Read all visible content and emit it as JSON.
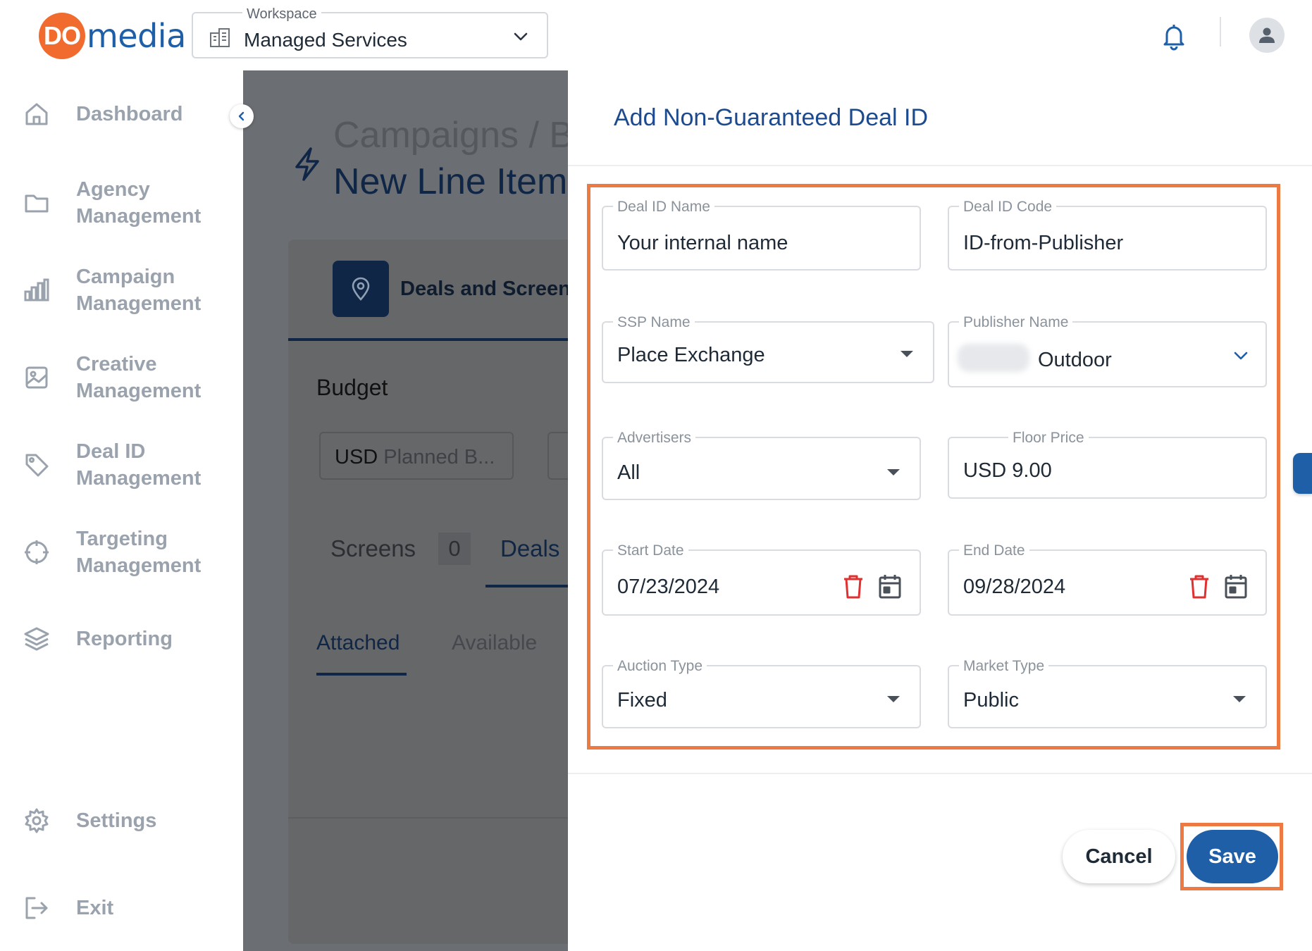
{
  "header": {
    "logo_mark": "DO",
    "logo_text": "media",
    "workspace_label": "Workspace",
    "workspace_value": "Managed Services"
  },
  "sidebar": {
    "items": [
      {
        "label": "Dashboard",
        "icon": "home-icon"
      },
      {
        "label": "Agency Management",
        "icon": "folder-icon"
      },
      {
        "label": "Campaign Management",
        "icon": "bar-chart-icon"
      },
      {
        "label": "Creative Management",
        "icon": "image-icon"
      },
      {
        "label": "Deal ID Management",
        "icon": "tag-icon"
      },
      {
        "label": "Targeting Management",
        "icon": "target-icon"
      },
      {
        "label": "Reporting",
        "icon": "layers-icon"
      },
      {
        "label": "Settings",
        "icon": "gear-icon"
      },
      {
        "label": "Exit",
        "icon": "logout-icon"
      }
    ]
  },
  "background_page": {
    "breadcrumb": "Campaigns / B",
    "title": "New Line Item",
    "step_label": "Deals and Screen",
    "budget_heading": "Budget",
    "budget_currency": "USD",
    "budget_placeholder": "Planned B...",
    "tab_screens": "Screens",
    "tab_screens_count": "0",
    "tab_deals": "Deals",
    "subtab_attached": "Attached",
    "subtab_available": "Available"
  },
  "modal": {
    "title": "Add Non-Guaranteed Deal ID",
    "fields": {
      "deal_id_name": {
        "label": "Deal ID Name",
        "value": "Your internal name"
      },
      "deal_id_code": {
        "label": "Deal ID Code",
        "value": "ID-from-Publisher"
      },
      "ssp_name": {
        "label": "SSP Name",
        "value": "Place Exchange"
      },
      "publisher_name": {
        "label": "Publisher Name",
        "value": "Outdoor"
      },
      "advertisers": {
        "label": "Advertisers",
        "value": "All"
      },
      "floor_price": {
        "label": "Floor Price",
        "value": "USD 9.00"
      },
      "start_date": {
        "label": "Start Date",
        "value": "07/23/2024"
      },
      "end_date": {
        "label": "End Date",
        "value": "09/28/2024"
      },
      "auction_type": {
        "label": "Auction Type",
        "value": "Fixed"
      },
      "market_type": {
        "label": "Market Type",
        "value": "Public"
      }
    },
    "cancel_label": "Cancel",
    "save_label": "Save"
  },
  "colors": {
    "brand_blue": "#1e5fa8",
    "brand_orange": "#f26b2e",
    "highlight": "#ee7a43",
    "delete_red": "#e03131",
    "nav_gray": "#9aa3ad"
  }
}
